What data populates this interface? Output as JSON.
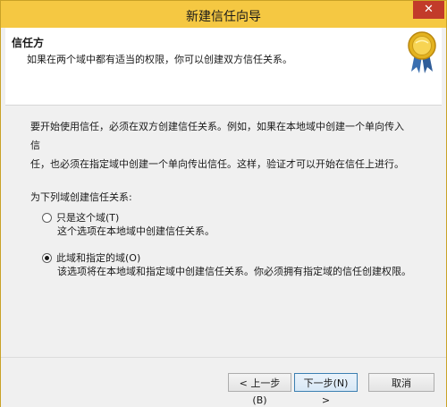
{
  "window": {
    "title": "新建信任向导",
    "close_label": "✕"
  },
  "header": {
    "title": "信任方",
    "description": "如果在两个域中都有适当的权限，你可以创建双方信任关系。",
    "icon": "certificate-ribbon-icon"
  },
  "body": {
    "intro_line1": "要开始使用信任，必须在双方创建信任关系。例如，如果在本地域中创建一个单向传入信",
    "intro_line2": "任，也必须在指定域中创建一个单向传出信任。这样，验证才可以开始在信任上进行。",
    "group_label": "为下列域创建信任关系:",
    "options": [
      {
        "label": "只是这个域(T)",
        "description": "这个选项在本地域中创建信任关系。",
        "checked": false
      },
      {
        "label": "此域和指定的域(O)",
        "description": "该选项将在本地域和指定域中创建信任关系。你必须拥有指定域的信任创建权限。",
        "checked": true
      }
    ]
  },
  "footer": {
    "back_label": "< 上一步(B)",
    "next_label": "下一步(N) >",
    "cancel_label": "取消"
  },
  "colors": {
    "titlebar": "#f5c842",
    "close": "#c23b2a",
    "primary_border": "#3c7fb1"
  }
}
